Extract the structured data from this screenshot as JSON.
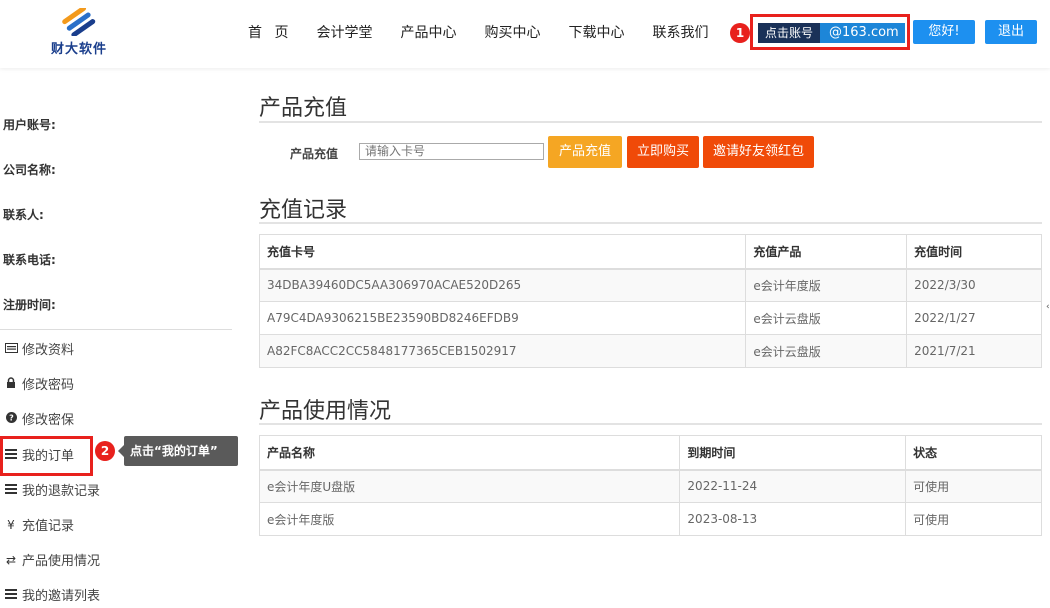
{
  "header": {
    "logo_text": "财大软件",
    "nav": [
      "首 页",
      "会计学堂",
      "产品中心",
      "购买中心",
      "下载中心",
      "联系我们"
    ],
    "badge_1": "1",
    "account_label": "点击账号",
    "account_email": "@163.com",
    "hello": "您好!",
    "logout": "退出"
  },
  "sidebar": {
    "info": [
      "用户账号:",
      "公司名称:",
      "联系人:",
      "联系电话:",
      "注册时间:"
    ],
    "menu": [
      {
        "icon": "id-card-icon",
        "label": "修改资料"
      },
      {
        "icon": "lock-icon",
        "label": "修改密码"
      },
      {
        "icon": "question-circle-icon",
        "label": "修改密保"
      },
      {
        "icon": "list-icon",
        "label": "我的订单"
      },
      {
        "icon": "list-icon",
        "label": "我的退款记录"
      },
      {
        "icon": "yen-icon",
        "label": "充值记录"
      },
      {
        "icon": "exchange-icon",
        "label": "产品使用情况"
      },
      {
        "icon": "list-icon",
        "label": "我的邀请列表"
      }
    ],
    "badge_2": "2",
    "tooltip": "点击“我的订单”"
  },
  "recharge": {
    "title": "产品充值",
    "label": "产品充值",
    "input_placeholder": "请输入卡号",
    "btn_recharge": "产品充值",
    "btn_buy": "立即购买",
    "btn_invite": "邀请好友领红包"
  },
  "records": {
    "title": "充值记录",
    "headers": [
      "充值卡号",
      "充值产品",
      "充值时间"
    ],
    "rows": [
      [
        "34DBA39460DC5AA306970ACAE520D265",
        "e会计年度版",
        "2022/3/30"
      ],
      [
        "A79C4DA9306215BE23590BD8246EFDB9",
        "e会计云盘版",
        "2022/1/27"
      ],
      [
        "A82FC8ACC2CC5848177365CEB1502917",
        "e会计云盘版",
        "2021/7/21"
      ]
    ]
  },
  "usage": {
    "title": "产品使用情况",
    "headers": [
      "产品名称",
      "到期时间",
      "状态"
    ],
    "rows": [
      [
        "e会计年度U盘版",
        "2022-11-24",
        "可使用"
      ],
      [
        "e会计年度版",
        "2023-08-13",
        "可使用"
      ]
    ]
  },
  "colors": {
    "accent_blue": "#1d90f0",
    "highlight_red": "#e8211d",
    "orange": "#f04a08",
    "yellow": "#f5a623"
  }
}
